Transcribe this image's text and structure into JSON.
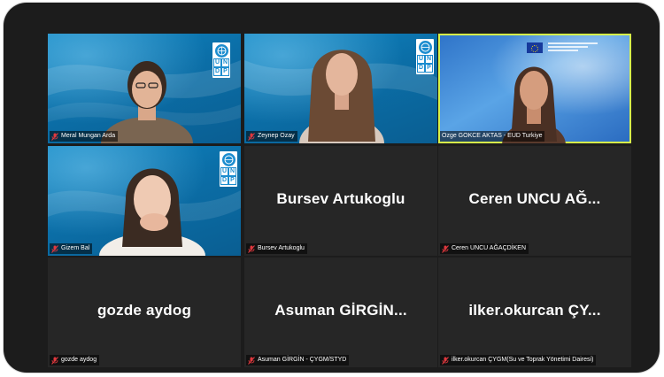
{
  "participants": [
    {
      "name": "Meral Mungan Arda",
      "muted": true,
      "video": true
    },
    {
      "name": "Zeynep Ozay",
      "muted": true,
      "video": true
    },
    {
      "name": "Ozge GOKCE AKTAS - EUD Turkiye",
      "muted": false,
      "video": true,
      "active_speaker": true
    },
    {
      "name": "Gizem Bal",
      "muted": true,
      "video": true
    },
    {
      "name": "Bursev Artukoglu",
      "display": "Bursev Artukoglu",
      "muted": true,
      "video": false
    },
    {
      "name": "Ceren UNCU AĞAÇDİKEN",
      "display": "Ceren UNCU AĞ...",
      "muted": true,
      "video": false
    },
    {
      "name": "gozde aydog",
      "display": "gozde aydog",
      "muted": true,
      "video": false
    },
    {
      "name": "Asuman GİRGİN - ÇYGM/STYD",
      "display": "Asuman GİRGİN...",
      "muted": true,
      "video": false
    },
    {
      "name": "ilker.okurcan ÇYGM(Su ve Toprak Yönetimi Dairesi)",
      "display": "ilker.okurcan ÇY...",
      "muted": true,
      "video": false
    }
  ],
  "undp_logo": {
    "letters": [
      "U",
      "N",
      "D",
      "P"
    ]
  },
  "colors": {
    "active_border": "#d6f24a",
    "mute_icon": "#e0383e",
    "frame": "#1c1c1c",
    "tile_empty": "#262626",
    "undp_blue": "#0b6fa8"
  },
  "icons": {
    "mute": "muted-microphone-icon",
    "logo": "undp-logo",
    "flag": "eu-flag"
  }
}
